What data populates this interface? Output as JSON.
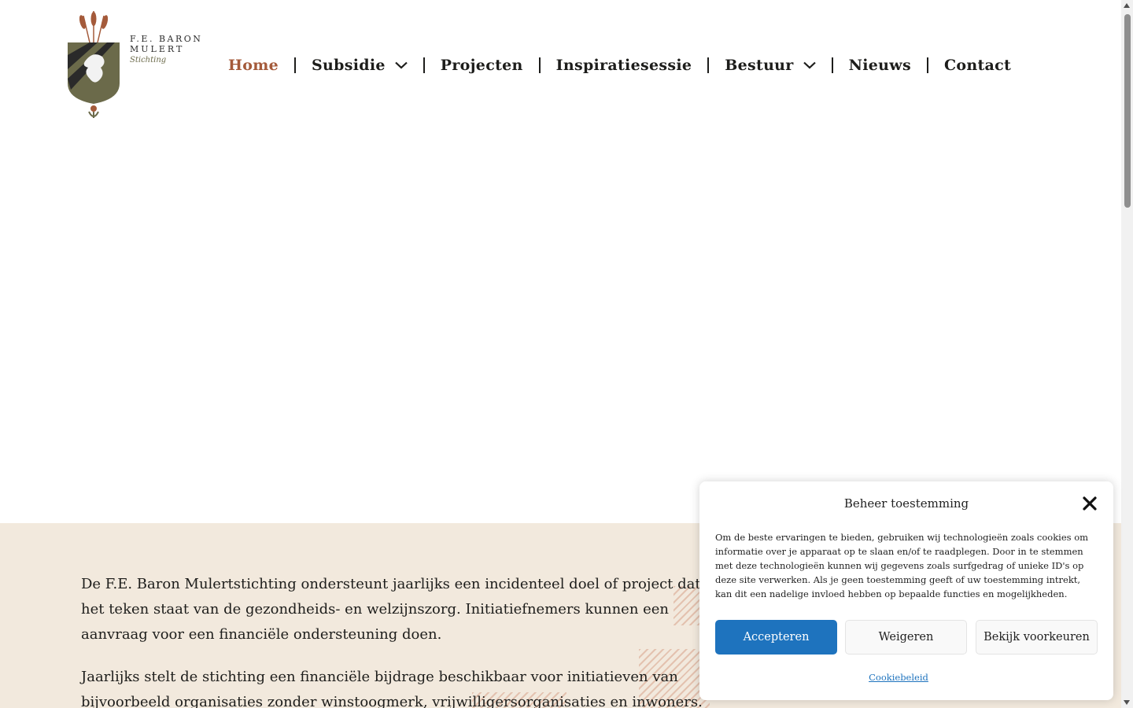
{
  "logo": {
    "line1": "F.E. BARON",
    "line2": "MULERT",
    "line3": "Stichting"
  },
  "nav": {
    "items": [
      {
        "label": "Home",
        "active": true,
        "dropdown": false
      },
      {
        "label": "Subsidie",
        "active": false,
        "dropdown": true
      },
      {
        "label": "Projecten",
        "active": false,
        "dropdown": false
      },
      {
        "label": "Inspiratiesessie",
        "active": false,
        "dropdown": false
      },
      {
        "label": "Bestuur",
        "active": false,
        "dropdown": true
      },
      {
        "label": "Nieuws",
        "active": false,
        "dropdown": false
      },
      {
        "label": "Contact",
        "active": false,
        "dropdown": false
      }
    ]
  },
  "content": {
    "paragraph1": "De F.E. Baron Mulertstichting ondersteunt jaarlijks een incidenteel doel of project dat in het teken staat van de gezondheids- en welzijnszorg. Initiatiefnemers kunnen een aanvraag voor een financiële ondersteuning doen.",
    "paragraph2": "Jaarlijks stelt de stichting een financiële bijdrage beschikbaar voor initiatieven van bijvoorbeeld organisaties zonder winstoogmerk, vrijwilligersorganisaties en inwoners. Hier zijn o.a. de volgende voorwaarden aan"
  },
  "cookie": {
    "title": "Beheer toestemming",
    "text": "Om de beste ervaringen te bieden, gebruiken wij technologieën zoals cookies om informatie over je apparaat op te slaan en/of te raadplegen. Door in te stemmen met deze technologieën kunnen wij gegevens zoals surfgedrag of unieke ID's op deze site verwerken. Als je geen toestemming geeft of uw toestemming intrekt, kan dit een nadelige invloed hebben op bepaalde functies en mogelijkheden.",
    "accept_label": "Accepteren",
    "deny_label": "Weigeren",
    "prefs_label": "Bekijk voorkeuren",
    "policy_label": "Cookiebeleid"
  },
  "colors": {
    "accent": "#a45a3a",
    "section_bg": "#f2e9dd",
    "button_primary": "#1e73be",
    "logo_olive": "#6b6a4a"
  }
}
